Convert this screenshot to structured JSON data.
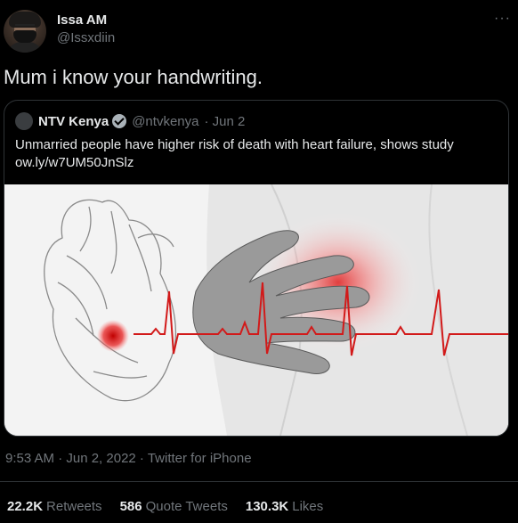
{
  "author": {
    "name": "Issa AM",
    "handle": "@Issxdiin"
  },
  "more_label": "···",
  "tweet": {
    "text": "Mum i know your handwriting."
  },
  "quoted": {
    "name": "NTV Kenya",
    "handle": "@ntvkenya",
    "date": "· Jun 2",
    "text": "Unmarried people have higher risk of death with heart failure, shows study",
    "link": "ow.ly/w7UM50JnSlz"
  },
  "meta": {
    "timestamp": "9:53 AM · Jun 2, 2022 · Twitter for iPhone"
  },
  "stats": {
    "retweets": {
      "count": "22.2K",
      "label": "Retweets"
    },
    "quotes": {
      "count": "586",
      "label": "Quote Tweets"
    },
    "likes": {
      "count": "130.3K",
      "label": "Likes"
    }
  },
  "colors": {
    "background": "#000000",
    "text": "#e7e9ea",
    "muted": "#71767b",
    "border": "#2f3336",
    "ecg": "#d21a1a"
  }
}
